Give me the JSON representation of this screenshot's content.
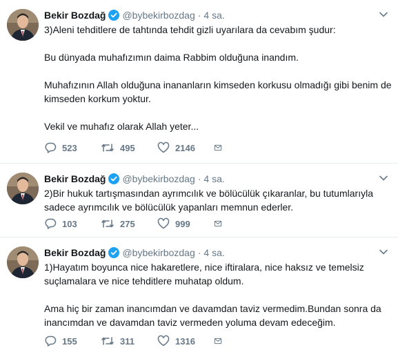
{
  "tweets": [
    {
      "name": "Bekir Bozdağ",
      "handle": "@bybekirbozdag",
      "separator": "·",
      "time": "4 sa.",
      "paragraphs": [
        "3)Aleni tehditlere de tahtında tehdit gizli uyarılara da cevabım şudur:",
        "Bu dünyada muhafızımın daima Rabbim olduğuna inandım.",
        "Muhafızının Allah olduğuna inananların kimseden korkusu olmadığı gibi benim de kimseden korkum yoktur.",
        "Vekil ve muhafız olarak Allah yeter..."
      ],
      "replies": "523",
      "retweets": "495",
      "likes": "2146"
    },
    {
      "name": "Bekir Bozdağ",
      "handle": "@bybekirbozdag",
      "separator": "·",
      "time": "4 sa.",
      "paragraphs": [
        "2)Bir hukuk tartışmasından ayrımcılık ve bölücülük çıkaranlar, bu tutumlarıyla sadece ayrımcılık ve bölücülük yapanları memnun ederler."
      ],
      "replies": "103",
      "retweets": "275",
      "likes": "999"
    },
    {
      "name": "Bekir Bozdağ",
      "handle": "@bybekirbozdag",
      "separator": "·",
      "time": "4 sa.",
      "paragraphs": [
        "1)Hayatım boyunca nice hakaretlere, nice iftiralara, nice haksız ve temelsiz suçlamalara ve nice tehditlere muhatap oldum.",
        "Ama hiç bir zaman inancımdan ve davamdan taviz vermedim.Bundan sonra da inancımdan ve davamdan taviz vermeden yoluma devam edeceğim."
      ],
      "replies": "155",
      "retweets": "311",
      "likes": "1316"
    }
  ],
  "icons": {
    "verified": "verified-badge-icon",
    "caret": "chevron-down-icon",
    "reply": "reply-icon",
    "retweet": "retweet-icon",
    "like": "heart-icon",
    "message": "envelope-icon"
  },
  "colors": {
    "verified": "#1da1f2",
    "muted": "#657786",
    "text": "#14171a",
    "border": "#e6ecf0"
  }
}
